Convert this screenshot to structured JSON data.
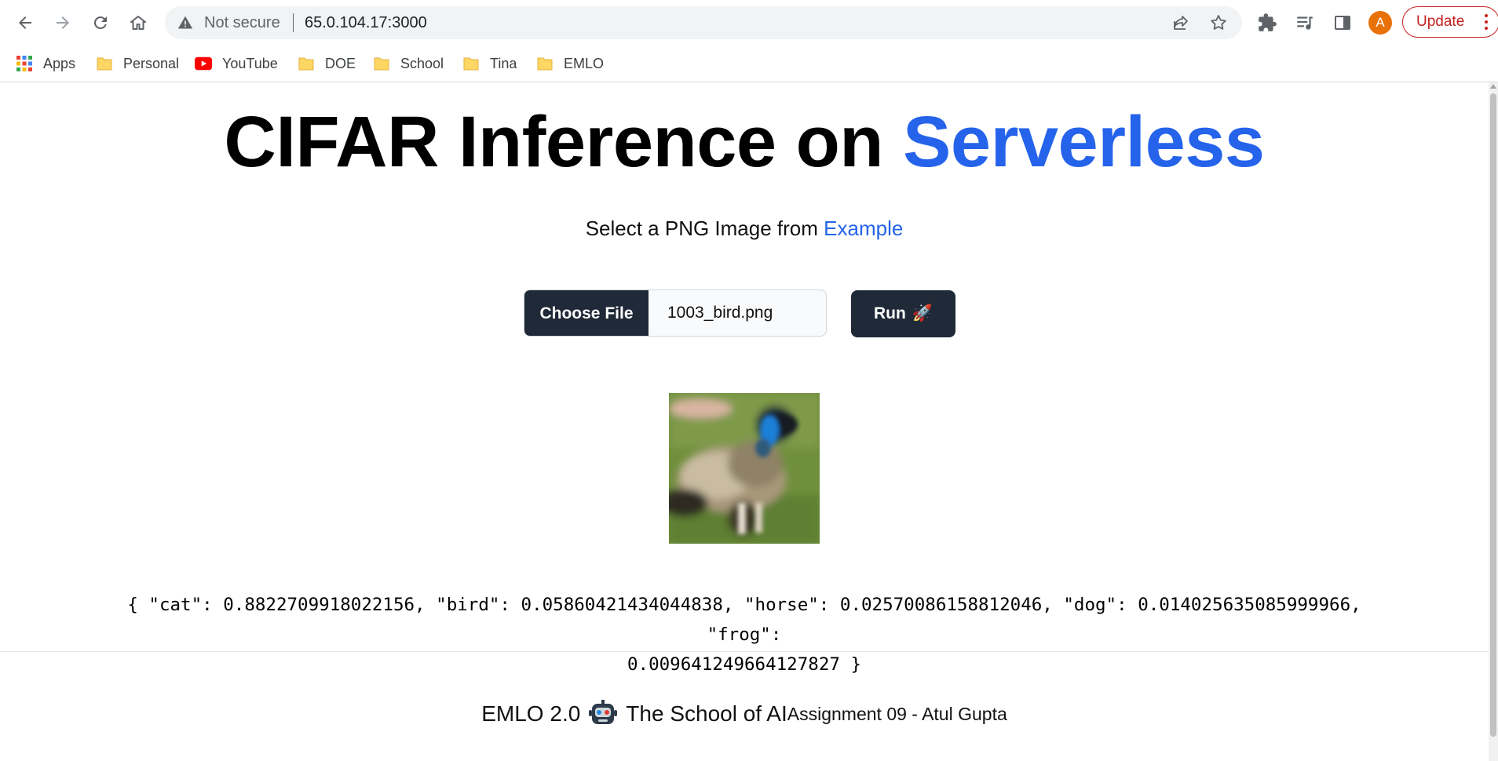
{
  "browser": {
    "security_label": "Not secure",
    "url": "65.0.104.17:3000",
    "avatar_letter": "A",
    "update_label": "Update"
  },
  "bookmarks": [
    {
      "label": "Apps",
      "icon": "apps-grid-icon"
    },
    {
      "label": "Personal",
      "icon": "folder-icon"
    },
    {
      "label": "YouTube",
      "icon": "youtube-icon"
    },
    {
      "label": "DOE",
      "icon": "folder-icon"
    },
    {
      "label": "School",
      "icon": "folder-icon"
    },
    {
      "label": "Tina",
      "icon": "folder-icon"
    },
    {
      "label": "EMLO",
      "icon": "folder-icon"
    }
  ],
  "page": {
    "title_main": "CIFAR Inference on",
    "title_accent": "Serverless",
    "subtitle_text": "Select a PNG Image from",
    "subtitle_link": "Example",
    "choose_file_label": "Choose File",
    "selected_file": "1003_bird.png",
    "run_label": "Run",
    "run_emoji": "🚀",
    "result_line1": "{ \"cat\": 0.8822709918022156, \"bird\": 0.05860421434044838, \"horse\": 0.02570086158812046, \"dog\": 0.014025635085999966, \"frog\":",
    "result_line2": "0.009641249664127827 }"
  },
  "footer": {
    "brand_prefix": "EMLO 2.0",
    "brand_suffix": "The School of AI",
    "assignment": "Assignment 09 - Atul Gupta"
  },
  "colors": {
    "accent": "#2563eb",
    "button_dark": "#1f2937",
    "update_red": "#c5221f",
    "avatar_orange": "#e8710a"
  }
}
